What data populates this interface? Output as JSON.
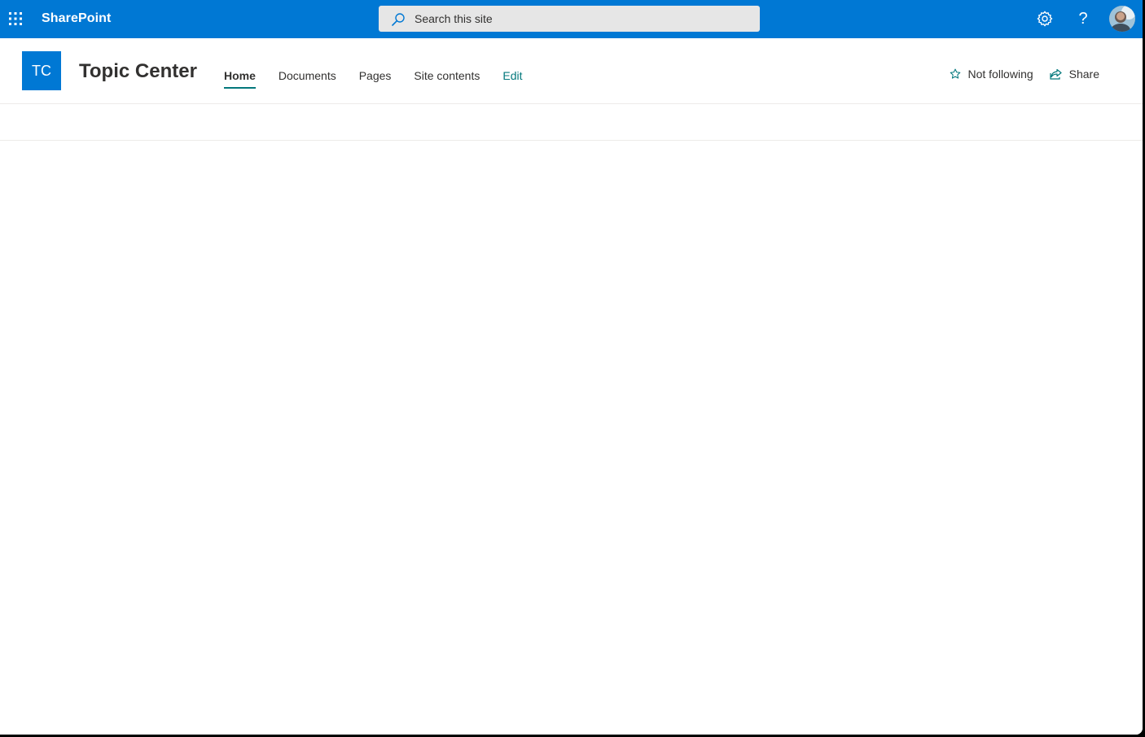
{
  "suite_bar": {
    "brand": "SharePoint",
    "search": {
      "placeholder": "Search this site",
      "value": ""
    },
    "help_symbol": "?",
    "icons": [
      "waffle-icon",
      "search-icon",
      "gear-icon",
      "help-icon",
      "avatar"
    ],
    "background_color": "#0078d4"
  },
  "site_header": {
    "logo_initials": "TC",
    "logo_color": "#0078d4",
    "title": "Topic Center",
    "nav": {
      "home": "Home",
      "documents": "Documents",
      "pages": "Pages",
      "site_contents": "Site contents",
      "edit": "Edit"
    },
    "active_nav": "Home",
    "accent_color": "#03787c",
    "actions": {
      "follow": "Not following",
      "share": "Share"
    }
  }
}
